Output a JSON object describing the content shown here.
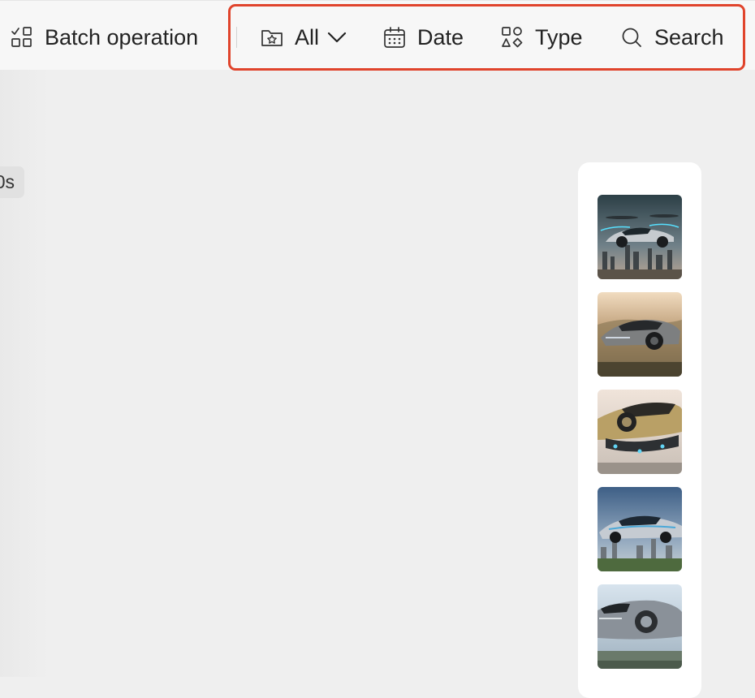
{
  "toolbar": {
    "batch_label": "Batch operation",
    "filter_label": "All",
    "date_label": "Date",
    "type_label": "Type",
    "search_label": "Search"
  },
  "timeline": {
    "duration_badge": "0s"
  },
  "thumbnails": [
    {
      "icon": "flying-car-city-thumbnail"
    },
    {
      "icon": "flying-car-desert-thumbnail"
    },
    {
      "icon": "flying-car-gold-thumbnail"
    },
    {
      "icon": "flying-car-silver-city-thumbnail"
    },
    {
      "icon": "flying-car-chrome-thumbnail"
    }
  ],
  "colors": {
    "highlight": "#e0442c",
    "background": "#efefef",
    "toolbar_bg": "#f7f7f7",
    "panel_bg": "#ffffff"
  }
}
